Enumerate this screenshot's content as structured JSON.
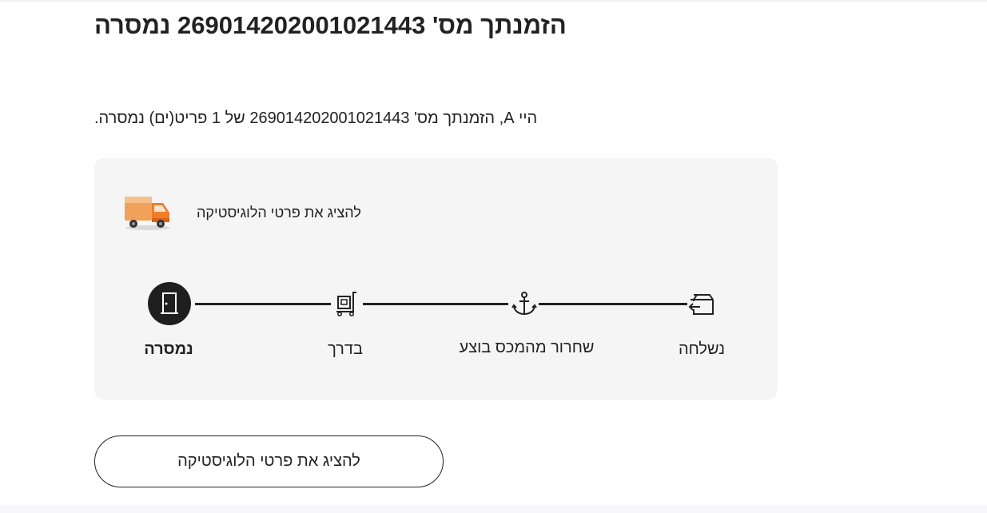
{
  "header": {
    "title": "הזמנתך מס' 269014202001021443 נמסרה"
  },
  "message": {
    "text": "היי A, הזמנתך מס' 269014202001021443 של 1 פריט(ים) נמסרה."
  },
  "logistics": {
    "icon": "truck-icon",
    "link_label": "להציג את פרטי הלוגיסטיקה"
  },
  "tracking": {
    "steps": [
      {
        "label": "נמסרה",
        "icon": "door-icon",
        "status": "current"
      },
      {
        "label": "בדרך",
        "icon": "hand-truck-icon",
        "status": "done"
      },
      {
        "label": "שחרור מהמכס בוצע",
        "icon": "anchor-icon",
        "status": "done"
      },
      {
        "label": "נשלחה",
        "icon": "box-return-icon",
        "status": "done"
      }
    ],
    "active_color": "#1f1f1f"
  },
  "footer": {
    "button_label": "להציג את פרטי הלוגיסטיקה"
  }
}
